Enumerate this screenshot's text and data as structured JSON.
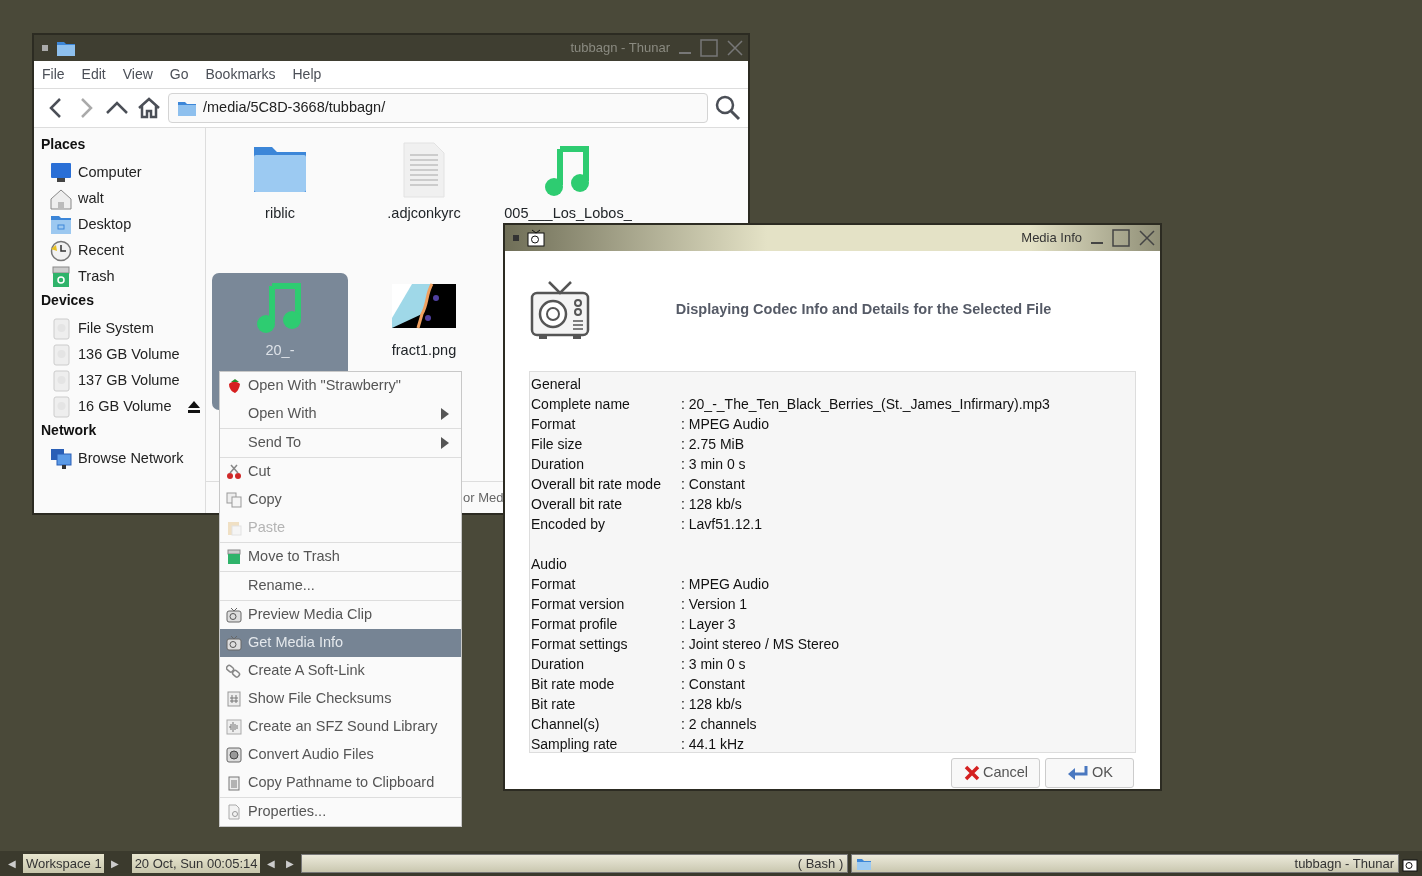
{
  "thunar": {
    "title": "tubbagn - Thunar",
    "menu": [
      "File",
      "Edit",
      "View",
      "Go",
      "Bookmarks",
      "Help"
    ],
    "path": "/media/5C8D-3668/tubbagn/",
    "sidebar": [
      {
        "heading": "Places",
        "items": [
          {
            "label": "Computer",
            "kind": "computer"
          },
          {
            "label": "walt",
            "kind": "home"
          },
          {
            "label": "Desktop",
            "kind": "desktop"
          },
          {
            "label": "Recent",
            "kind": "recent"
          },
          {
            "label": "Trash",
            "kind": "trash"
          }
        ]
      },
      {
        "heading": "Devices",
        "items": [
          {
            "label": "File System",
            "kind": "drive",
            "eject": false
          },
          {
            "label": "136 GB Volume",
            "kind": "drive",
            "eject": false
          },
          {
            "label": "137 GB Volume",
            "kind": "drive",
            "eject": false
          },
          {
            "label": "16 GB Volume",
            "kind": "drive",
            "eject": true
          }
        ]
      },
      {
        "heading": "Network",
        "items": [
          {
            "label": "Browse Network",
            "kind": "network"
          }
        ]
      }
    ],
    "files": [
      {
        "name": "riblic",
        "kind": "folder",
        "selected": false
      },
      {
        "name": ".adjconkyrc",
        "kind": "text",
        "selected": false
      },
      {
        "name": "005___Los_Lobos_",
        "kind": "audio",
        "selected": false
      },
      {
        "name": "20_-",
        "kind": "audio",
        "selected": true
      },
      {
        "name": "fract1.png",
        "selected": false
      }
    ],
    "status": "or Med"
  },
  "context_menu": {
    "groups": [
      [
        {
          "label": "Open With \"Strawberry\"",
          "kind": "strawberry",
          "submenu": false,
          "disabled": false,
          "selected": false
        },
        {
          "label": "Open With",
          "kind": "plain",
          "submenu": true,
          "disabled": false,
          "selected": false
        }
      ],
      [
        {
          "label": "Send To",
          "kind": "plain",
          "submenu": true,
          "disabled": false,
          "selected": false
        }
      ],
      [
        {
          "label": "Cut",
          "kind": "cut",
          "submenu": false,
          "disabled": false,
          "selected": false
        },
        {
          "label": "Copy",
          "kind": "copy",
          "submenu": false,
          "disabled": false,
          "selected": false
        },
        {
          "label": "Paste",
          "kind": "paste",
          "submenu": false,
          "disabled": true,
          "selected": false
        }
      ],
      [
        {
          "label": "Move to Trash",
          "kind": "trash",
          "submenu": false,
          "disabled": false,
          "selected": false
        }
      ],
      [
        {
          "label": "Rename...",
          "kind": "plain",
          "submenu": false,
          "disabled": false,
          "selected": false
        }
      ],
      [
        {
          "label": "Preview Media Clip",
          "kind": "media",
          "submenu": false,
          "disabled": false,
          "selected": false
        },
        {
          "label": "Get Media Info",
          "kind": "media",
          "submenu": false,
          "disabled": false,
          "selected": true
        },
        {
          "label": "Create A Soft-Link",
          "kind": "link",
          "submenu": false,
          "disabled": false,
          "selected": false
        },
        {
          "label": "Show File Checksums",
          "kind": "checksum",
          "submenu": false,
          "disabled": false,
          "selected": false
        },
        {
          "label": "Create an SFZ Sound Library",
          "kind": "sound",
          "submenu": false,
          "disabled": false,
          "selected": false
        },
        {
          "label": "Convert Audio Files",
          "kind": "convert",
          "submenu": false,
          "disabled": false,
          "selected": false
        },
        {
          "label": "Copy Pathname to Clipboard",
          "kind": "clipboard",
          "submenu": false,
          "disabled": false,
          "selected": false
        }
      ],
      [
        {
          "label": "Properties...",
          "kind": "properties",
          "submenu": false,
          "disabled": false,
          "selected": false
        }
      ]
    ]
  },
  "media_info": {
    "title": "Media Info",
    "heading": "Displaying Codec Info and Details for the Selected File",
    "sections": [
      {
        "heading": "General",
        "fields": [
          {
            "label": "Complete name",
            "value": ": 20_-_The_Ten_Black_Berries_(St._James_Infirmary).mp3"
          },
          {
            "label": "Format",
            "value": ": MPEG Audio"
          },
          {
            "label": "File size",
            "value": ": 2.75 MiB"
          },
          {
            "label": "Duration",
            "value": ": 3 min 0 s"
          },
          {
            "label": "Overall bit rate mode",
            "value": ": Constant"
          },
          {
            "label": "Overall bit rate",
            "value": ": 128 kb/s"
          },
          {
            "label": "Encoded by",
            "value": ": Lavf51.12.1"
          }
        ]
      },
      {
        "heading": "Audio",
        "fields": [
          {
            "label": "Format",
            "value": ": MPEG Audio"
          },
          {
            "label": "Format version",
            "value": ": Version 1"
          },
          {
            "label": "Format profile",
            "value": ": Layer 3"
          },
          {
            "label": "Format settings",
            "value": ": Joint stereo / MS Stereo"
          },
          {
            "label": "Duration",
            "value": ": 3 min 0 s"
          },
          {
            "label": "Bit rate mode",
            "value": ": Constant"
          },
          {
            "label": "Bit rate",
            "value": ": 128 kb/s"
          },
          {
            "label": "Channel(s)",
            "value": ": 2 channels"
          },
          {
            "label": "Sampling rate",
            "value": ": 44.1 kHz"
          }
        ]
      }
    ],
    "buttons": [
      {
        "label": "Cancel",
        "kind": "cancel"
      },
      {
        "label": "OK",
        "kind": "ok"
      }
    ]
  },
  "taskbar": {
    "prev": "◀",
    "workspace": "Workspace 1",
    "next": "▶",
    "clock": "20 Oct, Sun 00:05:14",
    "task_prev": "◀",
    "task_next": "▶",
    "tasks": [
      {
        "label": "( Bash )",
        "icon": false,
        "selected": false
      },
      {
        "label": "tubbagn - Thunar",
        "icon": true,
        "selected": false
      }
    ]
  }
}
